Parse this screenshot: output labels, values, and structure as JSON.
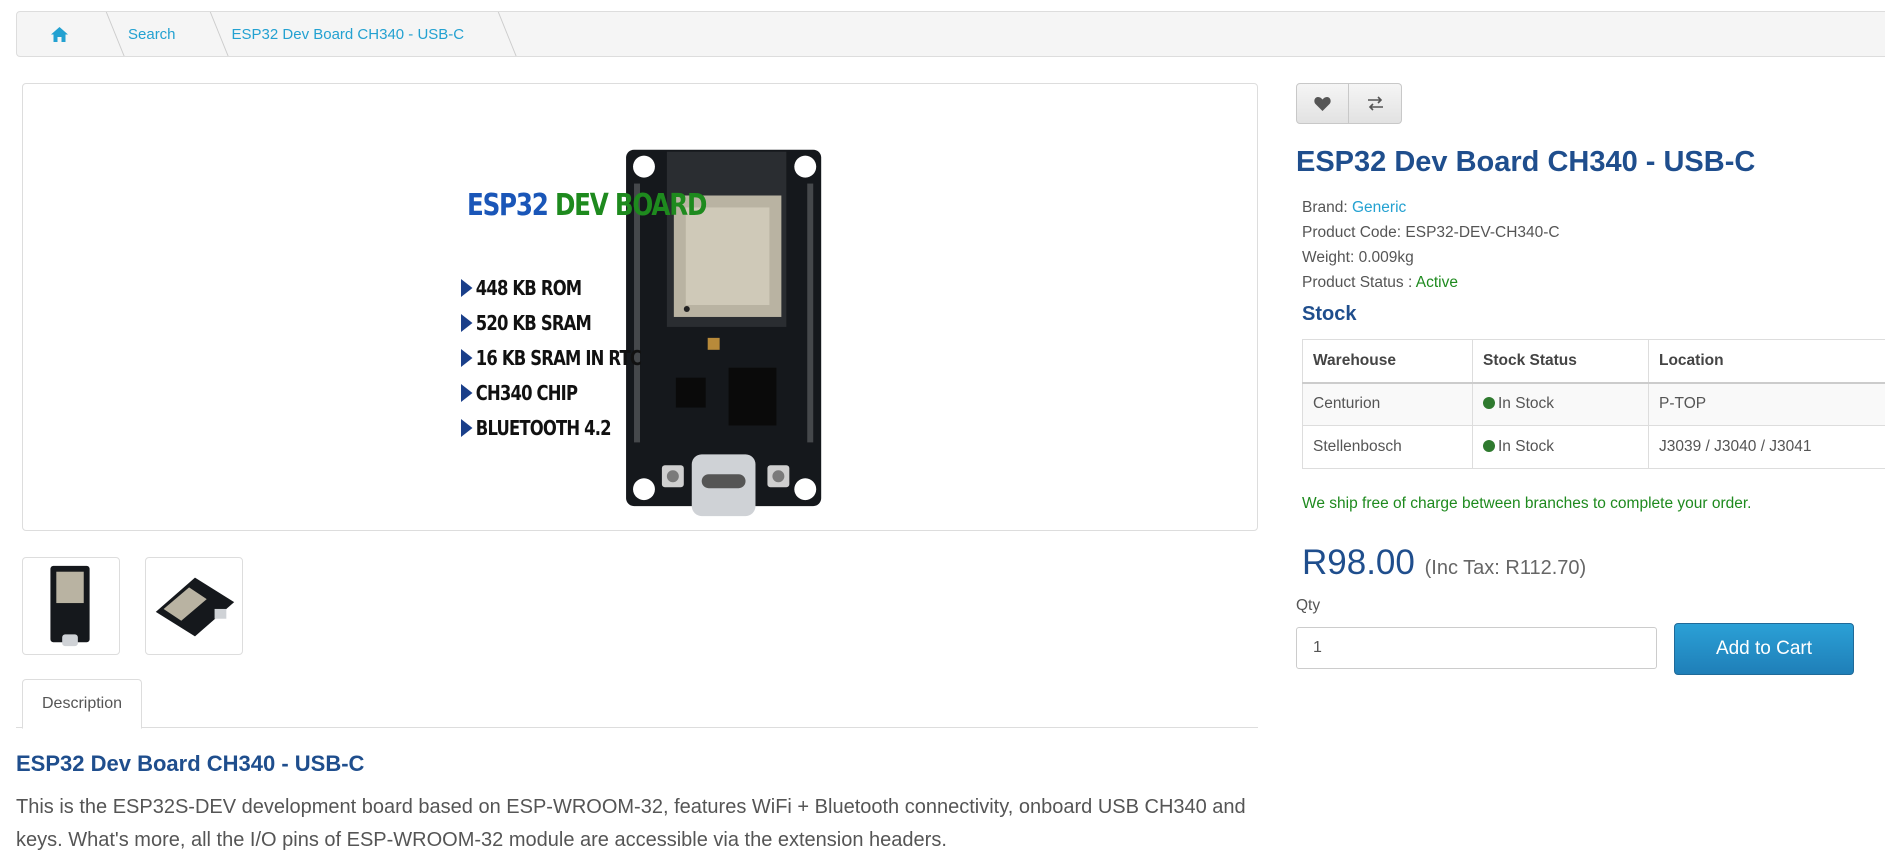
{
  "breadcrumb": {
    "home_icon": "home-icon",
    "items": [
      "Search",
      "ESP32 Dev Board CH340 - USB-C"
    ]
  },
  "image": {
    "title_part1": "ESP32",
    "title_part2": "DEV BOARD",
    "specs": [
      "448 KB ROM",
      "520 KB SRAM",
      "16 KB SRAM IN RTC",
      "CH340 CHIP",
      "BLUETOOTH 4.2"
    ]
  },
  "tabs": {
    "description": "Description"
  },
  "description": {
    "title": "ESP32 Dev Board CH340 - USB-C",
    "body": "This is the ESP32S-DEV development board based on ESP-WROOM-32, features WiFi + Bluetooth connectivity, onboard USB CH340 and keys. What's more, all the I/O pins of ESP-WROOM-32 module are accessible via the extension headers."
  },
  "actions": {
    "wishlist_icon": "heart-icon",
    "compare_icon": "exchange-icon"
  },
  "product": {
    "title": "ESP32 Dev Board CH340 - USB-C",
    "brand_label": "Brand:",
    "brand_value": "Generic",
    "code_label": "Product Code:",
    "code_value": "ESP32-DEV-CH340-C",
    "weight_label": "Weight:",
    "weight_value": "0.009kg",
    "status_label": "Product Status :",
    "status_value": "Active"
  },
  "stock": {
    "title": "Stock",
    "headers": [
      "Warehouse",
      "Stock Status",
      "Location"
    ],
    "rows": [
      {
        "warehouse": "Centurion",
        "status": "In Stock",
        "location": "P-TOP"
      },
      {
        "warehouse": "Stellenbosch",
        "status": "In Stock",
        "location": "J3039 / J3040 / J3041"
      }
    ],
    "status_color": "#2f7a2f"
  },
  "ship_note": "We ship free of charge between branches to complete your order.",
  "price": {
    "amount": "R98.00",
    "tax": "(Inc Tax: R112.70)"
  },
  "qty": {
    "label": "Qty",
    "value": "1"
  },
  "add_to_cart": "Add to Cart",
  "colors": {
    "link": "#23a1d1",
    "title": "#1f4e8d",
    "success": "#1e8a1e",
    "button": "#1f7fb8"
  }
}
